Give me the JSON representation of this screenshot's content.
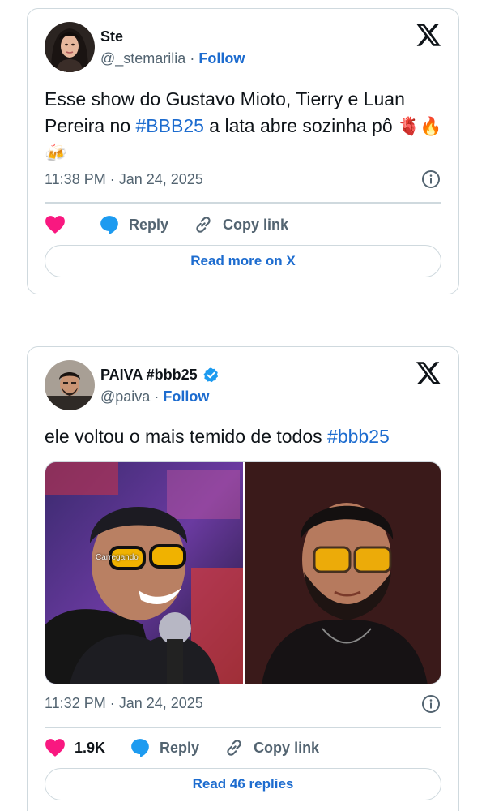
{
  "tweets": [
    {
      "author_name": "Ste",
      "handle": "@_stemarilia",
      "separator": "·",
      "follow_label": "Follow",
      "text_prefix": "Esse show do Gustavo Mioto, Tierry e Luan Pereira no ",
      "hashtag": "#BBB25",
      "text_suffix": " a lata abre sozinha pô",
      "emoji": "🫀🔥🍻",
      "timestamp": "11:38 PM · Jan 24, 2025",
      "like_count": "",
      "reply_label": "Reply",
      "copy_link_label": "Copy link",
      "cta_label": "Read more on X"
    },
    {
      "author_name": "PAIVA #bbb25",
      "verified": true,
      "handle": "@paiva",
      "separator": "·",
      "follow_label": "Follow",
      "text_prefix": "ele voltou o mais temido de todos ",
      "hashtag": "#bbb25",
      "timestamp": "11:32 PM · Jan 24, 2025",
      "like_count": "1.9K",
      "reply_label": "Reply",
      "copy_link_label": "Copy link",
      "cta_label": "Read 46 replies",
      "media_overlay_text": "Carregando"
    }
  ],
  "colors": {
    "accent": "#1d6ccf",
    "heart": "#f91880",
    "reply_bubble": "#1d9bf0",
    "muted": "#536471",
    "border": "#cfd9de"
  },
  "icons": {
    "platform": "x-logo-icon",
    "info": "info-icon",
    "like": "heart-icon",
    "reply": "reply-bubble-icon",
    "copy_link": "link-icon",
    "verified": "verified-badge-icon"
  }
}
